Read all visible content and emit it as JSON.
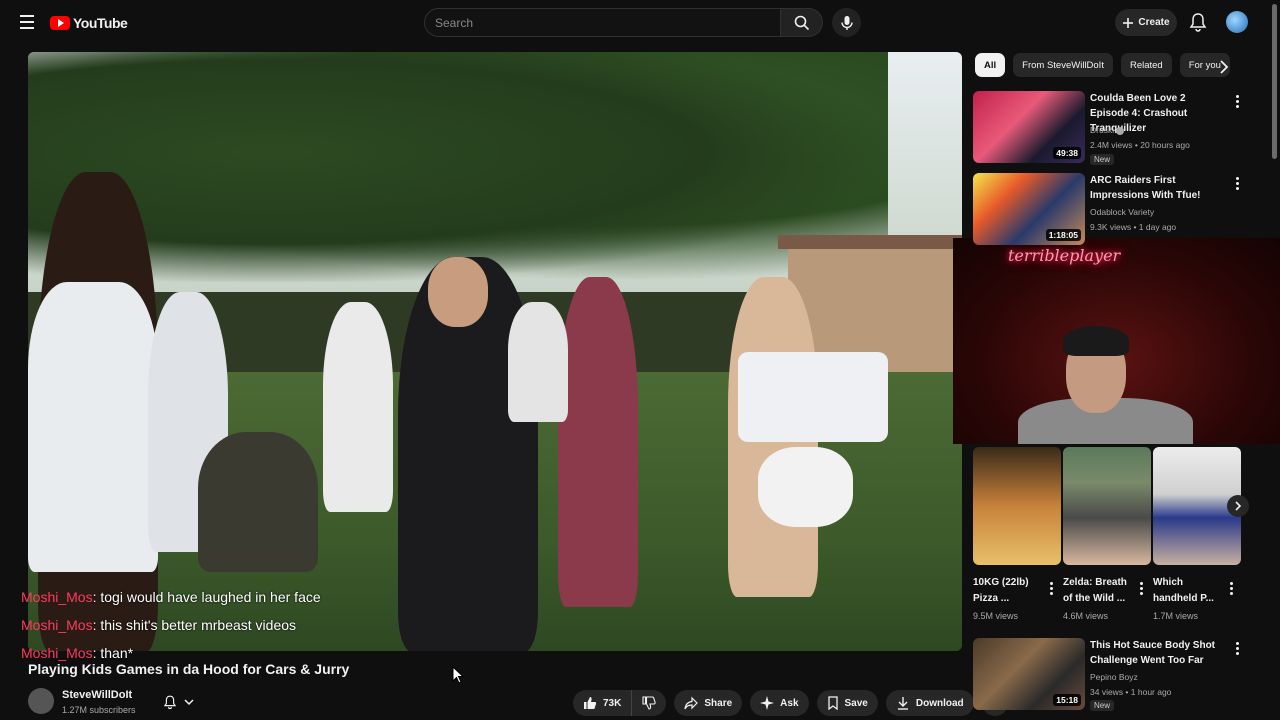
{
  "header": {
    "logo_text": "YouTube",
    "search_placeholder": "Search",
    "create_label": "Create"
  },
  "video": {
    "title": "Playing Kids Games in da Hood for Cars & Jurry",
    "channel_name": "SteveWillDoIt",
    "subscribers": "1.27M subscribers",
    "like_count": "73K",
    "share_label": "Share",
    "ask_label": "Ask",
    "save_label": "Save",
    "download_label": "Download"
  },
  "chat": [
    {
      "name": "Moshi_Mos",
      "text": ": togi would have laughed in her face"
    },
    {
      "name": "Moshi_Mos",
      "text": ": this shit's better mrbeast videos"
    },
    {
      "name": "Moshi_Mos",
      "text": ": than*"
    }
  ],
  "stream_overlay": {
    "neon_sign": "terribleplayer"
  },
  "chips": [
    "All",
    "From SteveWillDoIt",
    "Related",
    "For you"
  ],
  "recommendations": [
    {
      "title": "Coulda Been Love 2 Episode 4: Crashout Tranquilizer",
      "channel": "Druski",
      "meta": "2.4M views • 20 hours ago",
      "duration": "49:38",
      "badge": "New",
      "verified": true
    },
    {
      "title": "ARC Raiders First Impressions With Tfue!",
      "channel": "Odablock Variety",
      "meta": "9.3K views • 1 day ago",
      "duration": "1:18:05",
      "badge": "",
      "verified": false
    },
    {
      "title": "This Hot Sauce Body Shot Challenge Went Too Far",
      "channel": "Pepino Boyz",
      "meta": "34 views • 1 hour ago",
      "duration": "15:18",
      "badge": "New",
      "verified": false
    }
  ],
  "shorts": [
    {
      "title": "10KG (22lb) Pizza ...",
      "views": "9.5M views"
    },
    {
      "title": "Zelda: Breath of the Wild ...",
      "views": "4.6M views"
    },
    {
      "title": "Which handheld P...",
      "views": "1.7M views"
    }
  ],
  "colors": {
    "background": "#0f0f0f",
    "brand_red": "#ff0000",
    "chat_name": "#ff3b5c"
  }
}
